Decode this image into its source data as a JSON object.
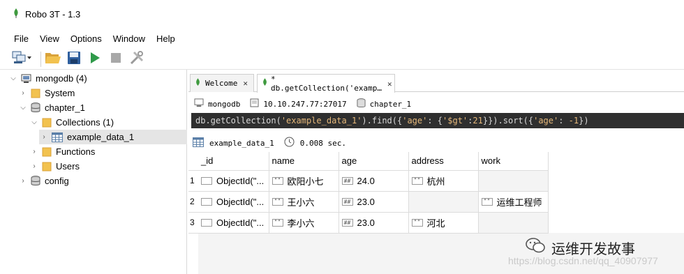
{
  "window": {
    "title": "Robo 3T - 1.3"
  },
  "menu": [
    "File",
    "View",
    "Options",
    "Window",
    "Help"
  ],
  "toolbar": {
    "buttons": [
      "connect-icon",
      "open-folder-icon",
      "save-icon",
      "run-icon",
      "stop-icon",
      "tools-icon"
    ]
  },
  "tree": {
    "root": {
      "label": "mongodb (4)"
    },
    "system": {
      "label": "System"
    },
    "db": {
      "label": "chapter_1"
    },
    "collections": {
      "label": "Collections (1)"
    },
    "collection": {
      "label": "example_data_1"
    },
    "functions": {
      "label": "Functions"
    },
    "users": {
      "label": "Users"
    },
    "config": {
      "label": "config"
    }
  },
  "tabs": [
    {
      "label": "Welcome"
    },
    {
      "label": "* db.getCollection('examp…"
    }
  ],
  "connection": {
    "name": "mongodb",
    "address": "10.10.247.77:27017",
    "database": "chapter_1"
  },
  "query": {
    "prefix": "db.getCollection(",
    "collection": "'example_data_1'",
    "find_open": ").find({",
    "age_key1": "'age'",
    "mid1": ": {",
    "gt_key": "'$gt'",
    "colon": ":",
    "gt_val": "21",
    "sort_open": "}}).sort({",
    "age_key2": "'age'",
    "mid2": ": ",
    "sort_val": "-1",
    "close": "})"
  },
  "result": {
    "collection": "example_data_1",
    "time": "0.008 sec."
  },
  "grid": {
    "columns": [
      "_id",
      "name",
      "age",
      "address",
      "work"
    ],
    "rows": [
      {
        "num": "1",
        "id": "ObjectId(\"...",
        "name": "欧阳小七",
        "age": "24.0",
        "address": "杭州",
        "work": ""
      },
      {
        "num": "2",
        "id": "ObjectId(\"...",
        "name": "王小六",
        "age": "23.0",
        "address": "",
        "work": "运维工程师"
      },
      {
        "num": "3",
        "id": "ObjectId(\"...",
        "name": "李小六",
        "age": "23.0",
        "address": "河北",
        "work": ""
      }
    ],
    "icons": {
      "string": "\"\"",
      "number": "##"
    }
  },
  "watermark": {
    "text": "运维开发故事",
    "url": "https://blog.csdn.net/qq_40907977"
  },
  "colors": {
    "query_bg": "#2f2f2f",
    "query_string": "#e6b87a",
    "mongo_green": "#3f9a3f",
    "folder": "#f2c24f"
  }
}
